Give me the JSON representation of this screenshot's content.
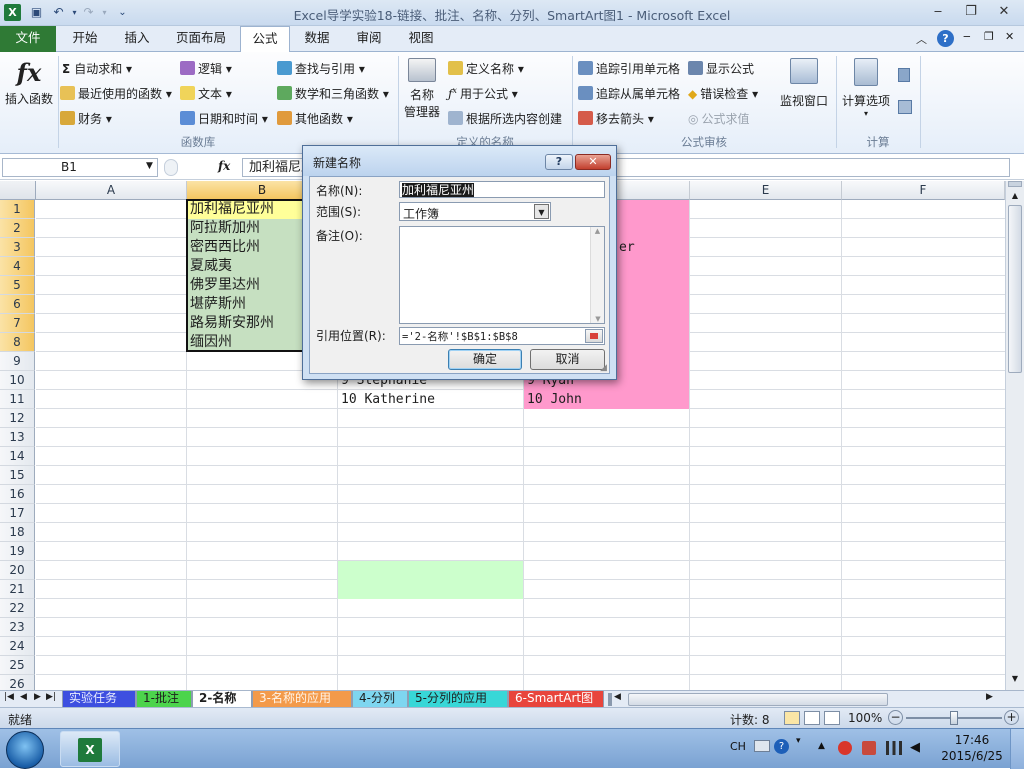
{
  "window": {
    "title": "Excel导学实验18-链接、批注、名称、分列、SmartArt图1 - Microsoft Excel",
    "minimize": "‒",
    "restore": "❐",
    "close": "✕"
  },
  "tabs": [
    {
      "label": "文件"
    },
    {
      "label": "开始"
    },
    {
      "label": "插入"
    },
    {
      "label": "页面布局"
    },
    {
      "label": "公式"
    },
    {
      "label": "数据"
    },
    {
      "label": "审阅"
    },
    {
      "label": "视图"
    }
  ],
  "ribbon": {
    "insert_function": "插入函数",
    "function_library": {
      "autosum": "自动求和",
      "recent": "最近使用的函数",
      "financial": "财务",
      "logical": "逻辑",
      "text": "文本",
      "datetime": "日期和时间",
      "lookup": "查找与引用",
      "math": "数学和三角函数",
      "more": "其他函数",
      "group_label": "函数库"
    },
    "defined_names": {
      "name_manager_line1": "名称",
      "name_manager_line2": "管理器",
      "define_name": "定义名称",
      "use_in_formula": "用于公式",
      "create_from_selection": "根据所选内容创建",
      "group_label": "定义的名称"
    },
    "formula_auditing": {
      "trace_precedents": "追踪引用单元格",
      "trace_dependents": "追踪从属单元格",
      "remove_arrows": "移去箭头",
      "show_formulas": "显示公式",
      "error_checking": "错误检查",
      "evaluate": "公式求值",
      "watch_window": "监视窗口",
      "group_label": "公式审核"
    },
    "calculation": {
      "options": "计算选项",
      "group_label": "计算"
    }
  },
  "formula_bar": {
    "name_box": "B1",
    "fx": "fx",
    "content": "加利福尼亚州"
  },
  "grid": {
    "columns": [
      "A",
      "B",
      "C",
      "D",
      "E",
      "F"
    ],
    "rows": [
      "1",
      "2",
      "3",
      "4",
      "5",
      "6",
      "7",
      "8",
      "9",
      "10",
      "11",
      "12",
      "13",
      "14",
      "15",
      "16",
      "17",
      "18",
      "19",
      "20",
      "21",
      "22",
      "23",
      "24",
      "25",
      "26"
    ],
    "col_b": [
      "加利福尼亚州",
      "阿拉斯加州",
      "密西西比州",
      "夏威夷",
      "佛罗里达州",
      "堪萨斯州",
      "路易斯安那州",
      "缅因州"
    ],
    "d3_partial": "er",
    "c10": "9 Stephanie",
    "d10": "9 Ryan",
    "c11": "10 Katherine",
    "d11": "10 John"
  },
  "sheets": [
    {
      "label": "实验任务",
      "color": "#3d4fe0"
    },
    {
      "label": "1-批注",
      "color": "#4cd44c"
    },
    {
      "label": "2-名称",
      "color": "#ffffff"
    },
    {
      "label": "3-名称的应用",
      "color": "#f39a4a"
    },
    {
      "label": "4-分列",
      "color": "#7ed6f0"
    },
    {
      "label": "5-分列的应用",
      "color": "#38d7d7"
    },
    {
      "label": "6-SmartArt图",
      "color": "#e8453c"
    }
  ],
  "status": {
    "ready": "就绪",
    "count": "计数: 8",
    "zoom": "100%"
  },
  "dialog": {
    "title": "新建名称",
    "name_label": "名称(N):",
    "name_value": "加利福尼亚州",
    "scope_label": "范围(S):",
    "scope_value": "工作簿",
    "comment_label": "备注(O):",
    "comment_value": "",
    "refers_label": "引用位置(R):",
    "refers_value": "='2-名称'!$B$1:$B$8",
    "ok": "确定",
    "cancel": "取消",
    "help": "?",
    "close": "✕"
  },
  "taskbar": {
    "lang": "CH",
    "time": "17:46",
    "date": "2015/6/25"
  },
  "colors": {
    "green": "#c6e0c1",
    "yellow": "#ffff99",
    "pink": "#ff99cc",
    "lightgreen": "#ccffcc",
    "file_tab": "#2f7a35"
  }
}
